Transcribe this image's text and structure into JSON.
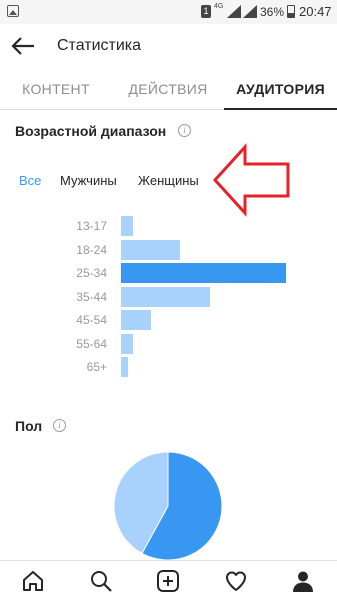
{
  "status_bar": {
    "sim_label": "1",
    "network": "4G",
    "battery": "36%",
    "time": "20:47"
  },
  "header": {
    "title": "Статистика"
  },
  "tabs": [
    {
      "label": "КОНТЕНТ",
      "active": false
    },
    {
      "label": "ДЕЙСТВИЯ",
      "active": false
    },
    {
      "label": "АУДИТОРИЯ",
      "active": true
    }
  ],
  "age_section": {
    "title": "Возрастной диапазон",
    "filters": [
      {
        "label": "Все",
        "active": true
      },
      {
        "label": "Мужчины",
        "active": false
      },
      {
        "label": "Женщины",
        "active": false
      }
    ]
  },
  "chart_data": {
    "type": "bar",
    "orientation": "horizontal",
    "categories": [
      "13-17",
      "18-24",
      "25-34",
      "35-44",
      "45-54",
      "55-64",
      "65+"
    ],
    "values": [
      7,
      36,
      100,
      54,
      18,
      7,
      4
    ],
    "highlight": "25-34",
    "colors": {
      "bar": "#a8d2fb",
      "highlight": "#3897f0"
    }
  },
  "gender_section": {
    "title": "Пол",
    "chart_data": {
      "type": "pie",
      "values": [
        58,
        42
      ],
      "colors": [
        "#3897f0",
        "#a8d2fb"
      ]
    }
  },
  "bottom_nav": [
    {
      "icon": "home-icon"
    },
    {
      "icon": "search-icon"
    },
    {
      "icon": "add-post-icon"
    },
    {
      "icon": "heart-icon"
    },
    {
      "icon": "profile-icon"
    }
  ],
  "annotation": {
    "icon": "red-arrow-icon",
    "color": "#e8202a"
  }
}
